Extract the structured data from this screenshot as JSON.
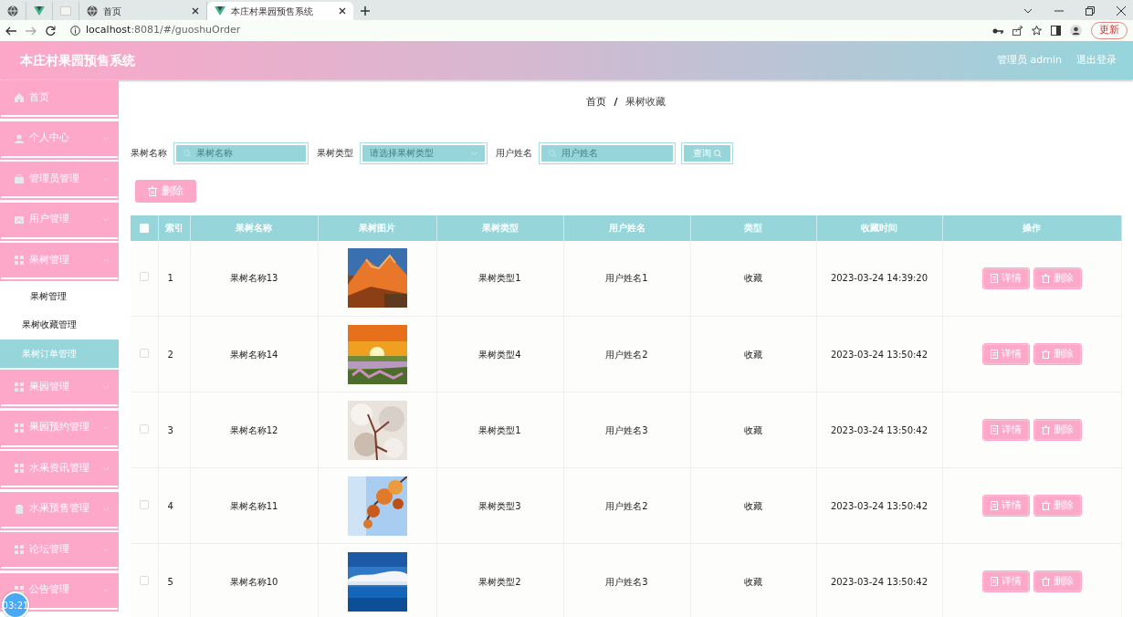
{
  "browser": {
    "tabs": [
      {
        "kind": "globe",
        "selected": false
      },
      {
        "kind": "vue",
        "selected": false
      },
      {
        "kind": "blank",
        "selected": false
      },
      {
        "kind": "page",
        "label": "首页",
        "selected": false
      },
      {
        "kind": "vue-page",
        "label": "本庄村果园预售系统",
        "selected": true
      }
    ],
    "url_host": "localhost",
    "url_rest": ":8081/#/guoshuOrder",
    "update_button": "更新"
  },
  "header": {
    "title": "本庄村果园预售系统",
    "user": "管理员 admin",
    "logout": "退出登录"
  },
  "sidebar": {
    "items": [
      {
        "label": "首页",
        "kind": "home"
      },
      {
        "label": "个人中心",
        "kind": "user",
        "expanded": false
      },
      {
        "label": "管理员管理",
        "kind": "case",
        "expanded": false
      },
      {
        "label": "用户管理",
        "kind": "card",
        "expanded": false
      },
      {
        "label": "果树管理",
        "kind": "grid",
        "expanded": true,
        "children": [
          {
            "label": "果树管理",
            "selected": false
          },
          {
            "label": "果树收藏管理",
            "selected": false
          },
          {
            "label": "果树订单管理",
            "selected": true
          }
        ]
      },
      {
        "label": "果园管理",
        "kind": "grid",
        "expanded": false
      },
      {
        "label": "果园预约管理",
        "kind": "grid",
        "expanded": false
      },
      {
        "label": "水果资讯管理",
        "kind": "grid",
        "expanded": false
      },
      {
        "label": "水果预售管理",
        "kind": "clip",
        "expanded": false
      },
      {
        "label": "论坛管理",
        "kind": "grid",
        "expanded": false
      },
      {
        "label": "公告管理",
        "kind": "grid",
        "expanded": false
      }
    ]
  },
  "breadcrumb": {
    "items": [
      "首页",
      "果树收藏"
    ],
    "separator": "/"
  },
  "filters": [
    {
      "label": "果树名称",
      "placeholder": "果树名称",
      "kind": "text"
    },
    {
      "label": "果树类型",
      "placeholder": "请选择果树类型",
      "kind": "select"
    },
    {
      "label": "用户姓名",
      "placeholder": "用户姓名",
      "kind": "text"
    }
  ],
  "search_button": "查询",
  "delete_button": "删除",
  "table": {
    "all_selected": false,
    "columns": [
      "索引",
      "果树名称",
      "果树图片",
      "果树类型",
      "用户姓名",
      "类型",
      "收藏时间",
      "操作"
    ],
    "rows": [
      {
        "selected": false,
        "index": "1",
        "name": "果树名称13",
        "type": "果树类型1",
        "user": "用户姓名1",
        "category": "收藏",
        "time": "2023-03-24 14:39:20",
        "actions": [
          "详情",
          "删除"
        ]
      },
      {
        "selected": false,
        "index": "2",
        "name": "果树名称14",
        "type": "果树类型4",
        "user": "用户姓名2",
        "category": "收藏",
        "time": "2023-03-24 13:50:42",
        "actions": [
          "详情",
          "删除"
        ]
      },
      {
        "selected": false,
        "index": "3",
        "name": "果树名称12",
        "type": "果树类型1",
        "user": "用户姓名3",
        "category": "收藏",
        "time": "2023-03-24 13:50:42",
        "actions": [
          "详情",
          "删除"
        ]
      },
      {
        "selected": false,
        "index": "4",
        "name": "果树名称11",
        "type": "果树类型3",
        "user": "用户姓名2",
        "category": "收藏",
        "time": "2023-03-24 13:50:42",
        "actions": [
          "详情",
          "删除"
        ]
      },
      {
        "selected": false,
        "index": "5",
        "name": "果树名称10",
        "type": "果树类型2",
        "user": "用户姓名3",
        "category": "收藏",
        "time": "2023-03-24 13:50:42",
        "actions": [
          "详情",
          "删除"
        ]
      }
    ]
  },
  "recorder_time": "03:21"
}
